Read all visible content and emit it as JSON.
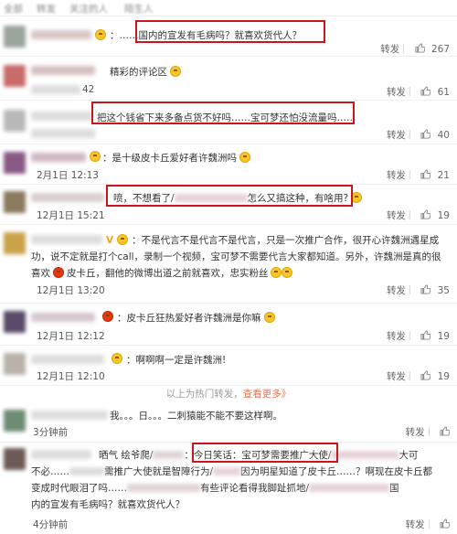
{
  "tabs": [
    "全部",
    "转发",
    "关注的人",
    "陌生人"
  ],
  "actions_like_icon": "thumbs-up-icon",
  "rows": [
    {
      "text_a": "：……",
      "text_b": "国内的宣发有毛病吗？就喜欢货代人？",
      "actions": {
        "repost": "转发",
        "count": "267"
      }
    },
    {
      "text_a": "精彩的评论区",
      "time": "42",
      "actions": {
        "repost": "转发",
        "count": "61"
      }
    },
    {
      "text_a": "把这个钱省下来多备点货不好吗……宝可梦还怕没流量吗……",
      "actions": {
        "repost": "转发",
        "count": "40"
      }
    },
    {
      "text_a": "：是十级皮卡丘爱好者许魏洲吗",
      "time": "2月1日 12:13",
      "actions": {
        "repost": "转发",
        "count": "21"
      }
    },
    {
      "text_a": "喷，不想看了/",
      "text_b": "怎么又搞这种，有啥用?",
      "time": "12月1日 15:21",
      "actions": {
        "repost": "转发",
        "count": "19"
      }
    },
    {
      "text_a": "：不是代言不是代言不是代言，只是一次推广合作，很开心许魏洲遇星成",
      "text_b": "功，说不定就是打个call，录制一个视频，宝可梦不需要代言大家都知道。另外，许魏洲是真的很",
      "text_c": "喜欢",
      "text_d": "皮卡丘，翻他的微博出道之前就喜欢，忠实粉丝",
      "time": "12月1日 13:20",
      "actions": {
        "repost": "转发",
        "count": "35"
      }
    },
    {
      "text_a": "：皮卡丘狂热爱好者许魏洲是你嘛",
      "time": "12月1日 12:12",
      "actions": {
        "repost": "转发",
        "count": "19"
      }
    },
    {
      "text_a": "：啊啊啊一定是许魏洲!",
      "time": "12月1日 12:10",
      "actions": {
        "repost": "转发",
        "count": "19"
      }
    },
    {
      "text_a": "以上为热门转发，",
      "text_b": "查看更多》"
    },
    {
      "text_a": "我。。。日。。。二刺猿能不能不要这样啊。",
      "time": "3分钟前",
      "actions": {
        "repost": "转发"
      }
    },
    {
      "text_a": "晒气 绘爷爬/",
      "text_b": "：今日笑话：宝可梦需要推广大使/",
      "text_c": "大可",
      "text_d": "不必……",
      "text_e": "需推广大使就是智障行为/",
      "text_f": "因为明星知道了皮卡丘……？啊现在皮卡丘都",
      "text_g": "变成时代眼泪了吗……",
      "text_h": "有些评论看得我脚趾抓地/",
      "text_i": "国",
      "text_j": "内的宣发有毛病吗？就喜欢货代人？",
      "time": "4分钟前",
      "actions": {
        "repost": "转发"
      }
    }
  ],
  "colors": {
    "highlight_box": "#c8161d",
    "link": "#eb7350",
    "vip": "#f5a623"
  }
}
